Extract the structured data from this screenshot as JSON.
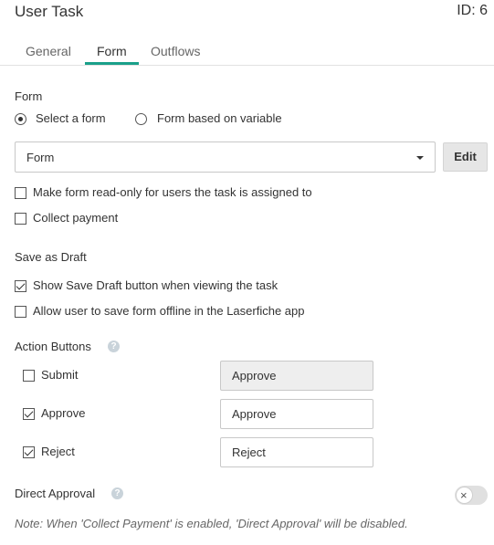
{
  "header": {
    "title": "User Task",
    "id_label": "ID: 6"
  },
  "tabs": [
    {
      "label": "General"
    },
    {
      "label": "Form",
      "active": true
    },
    {
      "label": "Outflows"
    }
  ],
  "form_section": {
    "label": "Form",
    "radio_select_form": {
      "label": "Select a form",
      "checked": true
    },
    "radio_variable": {
      "label": "Form based on variable",
      "checked": false
    },
    "select_value": "Form",
    "edit_label": "Edit",
    "read_only": {
      "label": "Make form read-only for users the task is assigned to",
      "checked": false
    },
    "collect_payment": {
      "label": "Collect payment",
      "checked": false
    }
  },
  "save_draft_section": {
    "label": "Save as Draft",
    "show_save_draft": {
      "label": "Show Save Draft button when viewing the task",
      "checked": true
    },
    "allow_offline": {
      "label": "Allow user to save form offline in the Laserfiche app",
      "checked": false
    }
  },
  "action_buttons_section": {
    "label": "Action Buttons",
    "help_icon": "?",
    "buttons": [
      {
        "label": "Submit",
        "checked": false,
        "value": "Approve",
        "disabled": true
      },
      {
        "label": "Approve",
        "checked": true,
        "value": "Approve",
        "disabled": false
      },
      {
        "label": "Reject",
        "checked": true,
        "value": "Reject",
        "disabled": false
      }
    ]
  },
  "direct_approval": {
    "label": "Direct Approval",
    "help_icon": "?",
    "toggle_icon": "×",
    "enabled": false
  },
  "note": "Note: When 'Collect Payment' is enabled, 'Direct Approval' will be disabled.",
  "colors": {
    "accent": "#1aa08a"
  }
}
